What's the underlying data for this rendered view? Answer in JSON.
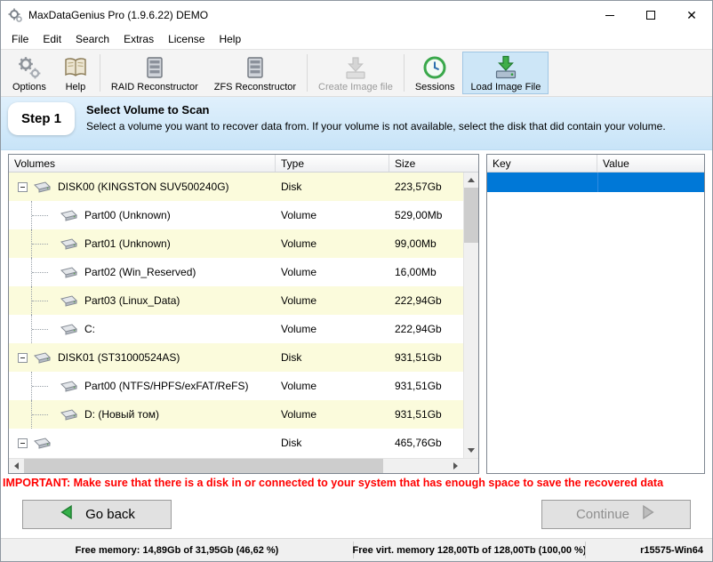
{
  "window": {
    "title": "MaxDataGenius Pro (1.9.6.22) DEMO"
  },
  "menu": {
    "items": [
      "File",
      "Edit",
      "Search",
      "Extras",
      "License",
      "Help"
    ]
  },
  "toolbar": {
    "items": [
      {
        "label": "Options",
        "icon": "gears-icon",
        "enabled": true,
        "active": false
      },
      {
        "label": "Help",
        "icon": "book-icon",
        "enabled": true,
        "active": false
      },
      {
        "label": "RAID Reconstructor",
        "icon": "raid-tower-icon",
        "enabled": true,
        "active": false
      },
      {
        "label": "ZFS Reconstructor",
        "icon": "zfs-tower-icon",
        "enabled": true,
        "active": false
      },
      {
        "label": "Create Image file",
        "icon": "create-image-icon",
        "enabled": false,
        "active": false
      },
      {
        "label": "Sessions",
        "icon": "sessions-clock-icon",
        "enabled": true,
        "active": false
      },
      {
        "label": "Load Image File",
        "icon": "load-image-drive-icon",
        "enabled": true,
        "active": true
      }
    ]
  },
  "step": {
    "badge": "Step 1",
    "title": "Select Volume to Scan",
    "description": "Select a volume you want to recover data from. If your volume is not available, select the disk that did contain your volume."
  },
  "volumes_table": {
    "columns": [
      "Volumes",
      "Type",
      "Size"
    ],
    "rows": [
      {
        "name": "DISK00 (KINGSTON SUV500240G)",
        "type": "Disk",
        "size": "223,57Gb",
        "level": 0
      },
      {
        "name": "Part00 (Unknown)",
        "type": "Volume",
        "size": "529,00Mb",
        "level": 1
      },
      {
        "name": "Part01 (Unknown)",
        "type": "Volume",
        "size": "99,00Mb",
        "level": 1
      },
      {
        "name": "Part02 (Win_Reserved)",
        "type": "Volume",
        "size": "16,00Mb",
        "level": 1
      },
      {
        "name": "Part03 (Linux_Data)",
        "type": "Volume",
        "size": "222,94Gb",
        "level": 1
      },
      {
        "name": "C:",
        "type": "Volume",
        "size": "222,94Gb",
        "level": 1
      },
      {
        "name": "DISK01 (ST31000524AS)",
        "type": "Disk",
        "size": "931,51Gb",
        "level": 0
      },
      {
        "name": "Part00 (NTFS/HPFS/exFAT/ReFS)",
        "type": "Volume",
        "size": "931,51Gb",
        "level": 1
      },
      {
        "name": "D: (Новый том)",
        "type": "Volume",
        "size": "931,51Gb",
        "level": 1
      },
      {
        "name": "",
        "type": "Disk",
        "size": "465,76Gb",
        "level": 0
      }
    ]
  },
  "details_table": {
    "columns": [
      "Key",
      "Value"
    ]
  },
  "warning": "IMPORTANT: Make sure that there is a disk in or connected to your system that has enough space to save the recovered data",
  "buttons": {
    "go_back": "Go back",
    "continue": "Continue"
  },
  "status_bar": {
    "free_memory": "Free memory: 14,89Gb of 31,95Gb (46,62 %)",
    "free_virtual_memory": "Free virt. memory 128,00Tb of 128,00Tb (100,00 %)",
    "build": "r15575-Win64"
  },
  "colors": {
    "selection_blue": "#0078d7",
    "warning_red": "#ff0000",
    "row_alt_yellow": "#fbfbdc",
    "active_tool_highlight": "#cde6f7"
  }
}
